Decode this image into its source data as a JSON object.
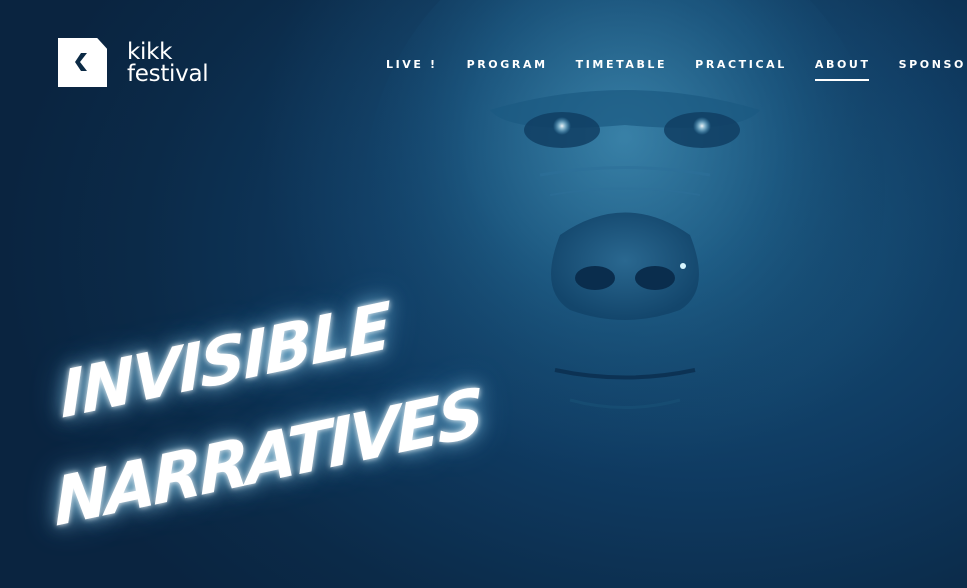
{
  "header": {
    "logo": {
      "line1": "kikk",
      "line2": "festival",
      "icon": "kikk-logo-icon"
    },
    "nav": [
      {
        "label": "LIVE !",
        "active": false
      },
      {
        "label": "PROGRAM",
        "active": false
      },
      {
        "label": "TIMETABLE",
        "active": false
      },
      {
        "label": "PRACTICAL",
        "active": false
      },
      {
        "label": "ABOUT",
        "active": true
      },
      {
        "label": "SPONSORS",
        "active": false
      }
    ]
  },
  "hero": {
    "title_line1": "INVISIBLE",
    "title_line2": "NARRATIVES",
    "image": "gorilla-photo"
  },
  "colors": {
    "background": "#0b2a45",
    "accent": "#ffffff",
    "glow": "#a0e6ff"
  }
}
